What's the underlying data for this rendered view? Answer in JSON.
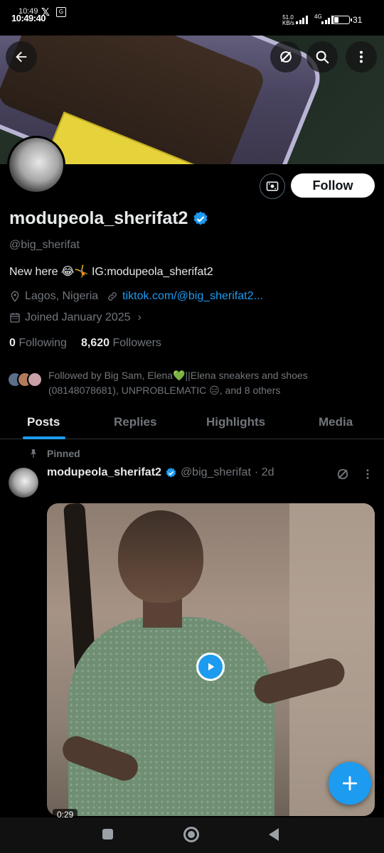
{
  "status_bar": {
    "time": "10:49:40",
    "time_small": "10:49",
    "network_speed": "51.0 KB/s",
    "network_type": "4G",
    "battery": "31",
    "battery_level": 0.31
  },
  "profile": {
    "display_name": "modupeola_sherifat2",
    "handle": "@big_sherifat",
    "bio": "New here 😂🤸 IG:modupeola_sherifat2",
    "location": "Lagos, Nigeria",
    "website": "tiktok.com/@big_sherifat2...",
    "joined": "Joined January 2025",
    "following_count": "0",
    "following_label": "Following",
    "followers_count": "8,620",
    "followers_label": "Followers",
    "followed_by": "Followed by Big Sam, Elena💚||Elena sneakers and shoes (08148078681), UNPROBLEMATIC 😑, and 8 others",
    "follow_button": "Follow"
  },
  "tabs": [
    "Posts",
    "Replies",
    "Highlights",
    "Media"
  ],
  "post": {
    "pinned_label": "Pinned",
    "author": "modupeola_sherifat2",
    "handle": "@big_sherifat",
    "time": "· 2d",
    "duration": "0:29"
  },
  "colors": {
    "accent": "#1d9bf0",
    "background": "#000000",
    "secondary_text": "#71767b"
  }
}
